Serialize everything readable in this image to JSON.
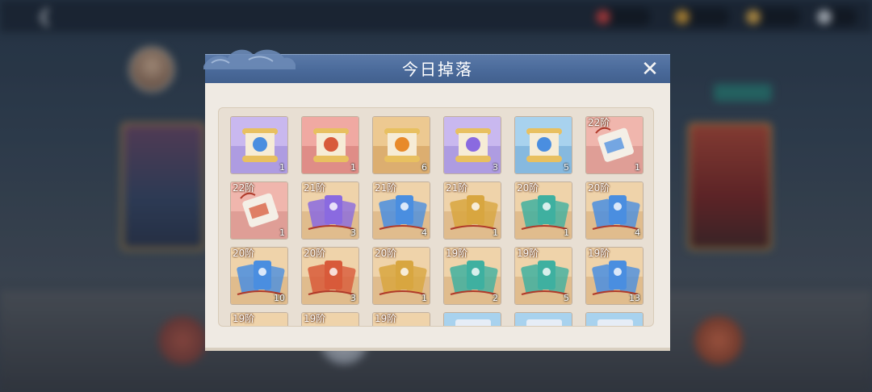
{
  "background": {
    "back_label": "",
    "resources": [
      "",
      "",
      "",
      ""
    ]
  },
  "dialog": {
    "title": "今日掉落",
    "close_glyph": "✕"
  },
  "colors": {
    "purple": "#b9a6e8",
    "red": "#e6938c",
    "gold": "#e3b577",
    "blue": "#8ec1e6",
    "salmon": "#e8a19a",
    "tan": "#e6c59a"
  },
  "items": [
    {
      "tier": "",
      "count": "1",
      "rarity": "purple",
      "icon": "scroll-blue-orb-icon"
    },
    {
      "tier": "",
      "count": "1",
      "rarity": "red",
      "icon": "scroll-red-orb-icon"
    },
    {
      "tier": "",
      "count": "6",
      "rarity": "gold",
      "icon": "scroll-orange-orb-icon"
    },
    {
      "tier": "",
      "count": "3",
      "rarity": "purple",
      "icon": "scroll-purple-orb-icon"
    },
    {
      "tier": "",
      "count": "5",
      "rarity": "blue",
      "icon": "scroll-blue-orb-icon"
    },
    {
      "tier": "22阶",
      "count": "1",
      "rarity": "salmon",
      "icon": "tied-scroll-blue-icon"
    },
    {
      "tier": "22阶",
      "count": "1",
      "rarity": "salmon",
      "icon": "tied-scroll-red-icon"
    },
    {
      "tier": "21阶",
      "count": "3",
      "rarity": "tan",
      "icon": "bound-scrolls-purple-icon"
    },
    {
      "tier": "21阶",
      "count": "4",
      "rarity": "tan",
      "icon": "bound-scrolls-blue-icon"
    },
    {
      "tier": "21阶",
      "count": "1",
      "rarity": "tan",
      "icon": "bound-scrolls-gold-icon"
    },
    {
      "tier": "20阶",
      "count": "1",
      "rarity": "tan",
      "icon": "bound-scrolls-teal-icon"
    },
    {
      "tier": "20阶",
      "count": "4",
      "rarity": "tan",
      "icon": "bound-scrolls-blue-icon"
    },
    {
      "tier": "20阶",
      "count": "10",
      "rarity": "tan",
      "icon": "bound-scrolls-blue-icon"
    },
    {
      "tier": "20阶",
      "count": "3",
      "rarity": "tan",
      "icon": "bound-scrolls-red-icon"
    },
    {
      "tier": "20阶",
      "count": "1",
      "rarity": "tan",
      "icon": "bound-scrolls-gold-icon"
    },
    {
      "tier": "19阶",
      "count": "2",
      "rarity": "tan",
      "icon": "bound-scrolls-teal-icon"
    },
    {
      "tier": "19阶",
      "count": "5",
      "rarity": "tan",
      "icon": "bound-scrolls-teal-icon"
    },
    {
      "tier": "19阶",
      "count": "13",
      "rarity": "tan",
      "icon": "bound-scrolls-blue-icon"
    },
    {
      "tier": "19阶",
      "count": "",
      "rarity": "tan",
      "icon": "bound-scrolls-red-icon"
    },
    {
      "tier": "19阶",
      "count": "",
      "rarity": "tan",
      "icon": "bound-scrolls-gold-icon"
    },
    {
      "tier": "19阶",
      "count": "",
      "rarity": "tan",
      "icon": "bound-scrolls-gold-icon"
    },
    {
      "tier": "",
      "count": "",
      "rarity": "blue",
      "icon": "item-partial-icon"
    },
    {
      "tier": "",
      "count": "",
      "rarity": "blue",
      "icon": "item-partial-icon"
    },
    {
      "tier": "",
      "count": "",
      "rarity": "blue",
      "icon": "item-partial-icon"
    }
  ]
}
